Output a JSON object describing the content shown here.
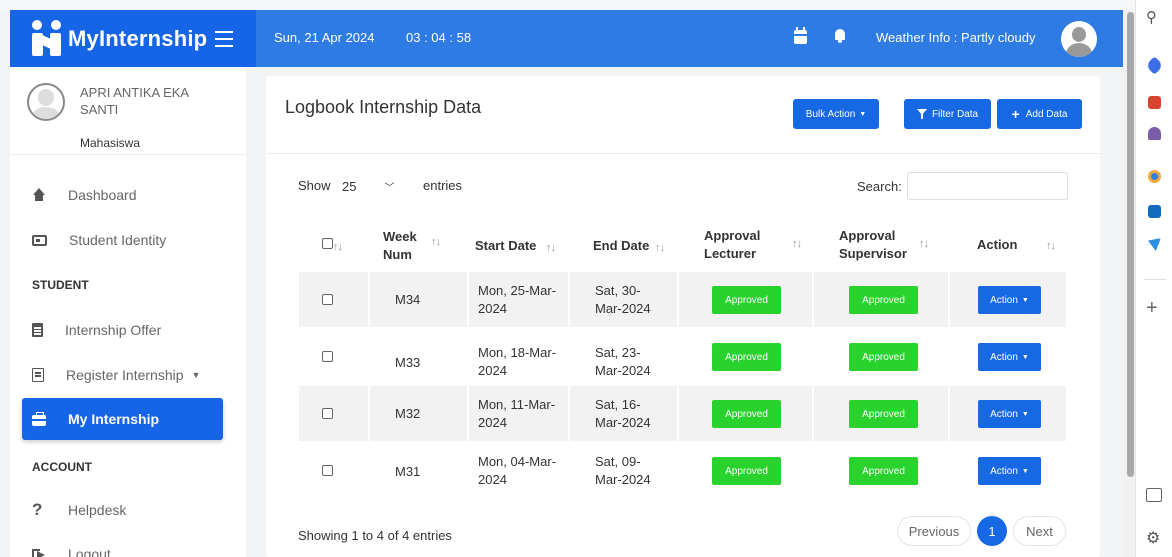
{
  "header": {
    "brand": "MyInternship",
    "date": "Sun, 21 Apr 2024",
    "time": "03 : 04 : 58",
    "weather": "Weather Info : Partly cloudy"
  },
  "sidebar": {
    "profile": {
      "name": "APRI ANTIKA EKA SANTI",
      "role": "Mahasiswa"
    },
    "items": [
      {
        "label": "Dashboard",
        "icon": "home-icon"
      },
      {
        "label": "Student Identity",
        "icon": "id-card-icon"
      }
    ],
    "student_heading": "STUDENT",
    "student_items": [
      {
        "label": "Internship Offer",
        "icon": "document-icon"
      },
      {
        "label": "Register Internship",
        "icon": "form-icon"
      },
      {
        "label": "My Internship",
        "icon": "briefcase-icon",
        "active": true
      }
    ],
    "account_heading": "ACCOUNT",
    "account_items": [
      {
        "label": "Helpdesk",
        "icon": "help-icon"
      },
      {
        "label": "Logout",
        "icon": "logout-icon"
      }
    ]
  },
  "main": {
    "title": "Logbook Internship Data",
    "bulk_action": "Bulk Action",
    "filter_data": "Filter Data",
    "add_data": "Add Data",
    "show_label": "Show",
    "entries_value": "25",
    "entries_label": "entries",
    "search_label": "Search:",
    "search_value": "",
    "columns": {
      "week_num": "Week Num",
      "start_date": "Start Date",
      "end_date": "End Date",
      "approval_lecturer": "Approval Lecturer",
      "approval_supervisor": "Approval Supervisor",
      "action": "Action"
    },
    "rows": [
      {
        "week": "M34",
        "start": "Mon, 25-Mar-2024",
        "end": "Sat, 30-Mar-2024",
        "lecturer": "Approved",
        "supervisor": "Approved",
        "action": "Action"
      },
      {
        "week": "M33",
        "start": "Mon, 18-Mar-2024",
        "end": "Sat, 23-Mar-2024",
        "lecturer": "Approved",
        "supervisor": "Approved",
        "action": "Action"
      },
      {
        "week": "M32",
        "start": "Mon, 11-Mar-2024",
        "end": "Sat, 16-Mar-2024",
        "lecturer": "Approved",
        "supervisor": "Approved",
        "action": "Action"
      },
      {
        "week": "M31",
        "start": "Mon, 04-Mar-2024",
        "end": "Sat, 09-Mar-2024",
        "lecturer": "Approved",
        "supervisor": "Approved",
        "action": "Action"
      }
    ],
    "info": "Showing 1 to 4 of 4 entries",
    "pagination": {
      "previous": "Previous",
      "page": "1",
      "next": "Next"
    }
  },
  "colors": {
    "header": "#2e7be4",
    "brand": "#1565e6",
    "primary_button": "#1668e3",
    "approved": "#2ad22d"
  }
}
